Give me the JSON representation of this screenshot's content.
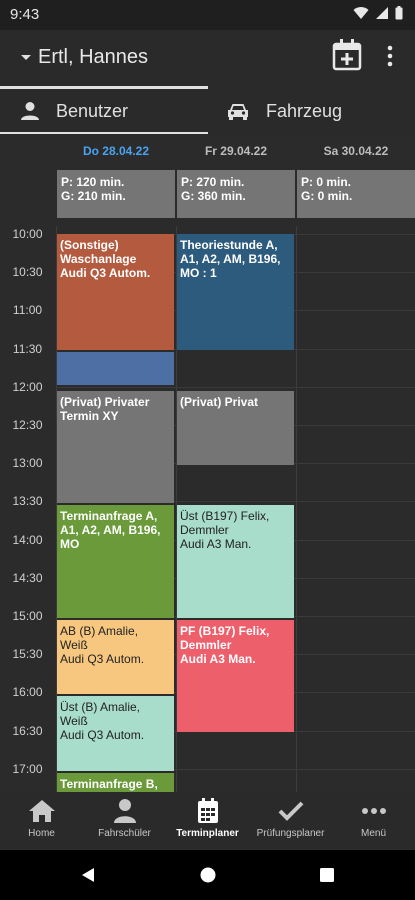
{
  "status": {
    "time": "9:43"
  },
  "appbar": {
    "title": "Ertl, Hannes"
  },
  "tabs": [
    {
      "label": "Benutzer",
      "icon": "person-icon",
      "active": true
    },
    {
      "label": "Fahrzeug",
      "icon": "car-icon",
      "active": false
    }
  ],
  "days": [
    {
      "label": "Do 28.04.22",
      "today": true,
      "summary_p": "P: 120 min.",
      "summary_g": "G: 210 min."
    },
    {
      "label": "Fr 29.04.22",
      "today": false,
      "summary_p": "P: 270 min.",
      "summary_g": "G: 360 min."
    },
    {
      "label": "Sa 30.04.22",
      "today": false,
      "summary_p": "P: 0 min.",
      "summary_g": "G: 0 min."
    }
  ],
  "hours": [
    "10:00",
    "10:30",
    "11:00",
    "11:30",
    "12:00",
    "12:30",
    "13:00",
    "13:30",
    "14:00",
    "14:30",
    "15:00",
    "15:30",
    "16:00",
    "16:30",
    "17:00"
  ],
  "events": [
    {
      "day": 0,
      "lines": [
        "(Sonstige)",
        "Waschanlage",
        "Audi Q3 Autom."
      ],
      "color": "#b35a3f"
    },
    {
      "day": 0,
      "lines": [],
      "color": "#4d6fa3"
    },
    {
      "day": 0,
      "lines": [
        "(Privat) Privater",
        "Termin XY"
      ],
      "color": "#757575"
    },
    {
      "day": 0,
      "lines": [
        "Terminanfrage A,",
        "A1, A2, AM, B196,",
        "MO"
      ],
      "color": "#6a9a3a"
    },
    {
      "day": 0,
      "lines": [
        "AB (B) Amalie,",
        "Weiß",
        "Audi Q3 Autom."
      ],
      "color": "#f7c77f"
    },
    {
      "day": 0,
      "lines": [
        "Üst (B) Amalie,",
        "Weiß",
        "Audi Q3 Autom."
      ],
      "color": "#a8dccb"
    },
    {
      "day": 0,
      "lines": [
        "Terminanfrage B,"
      ],
      "color": "#6a9a3a"
    },
    {
      "day": 1,
      "lines": [
        "Theoriestunde A,",
        "A1, A2, AM, B196,",
        "MO : 1"
      ],
      "color": "#2d5b7e"
    },
    {
      "day": 1,
      "lines": [
        "(Privat) Privat"
      ],
      "color": "#757575"
    },
    {
      "day": 1,
      "lines": [
        "Üst (B197) Felix,",
        "Demmler",
        "Audi A3 Man."
      ],
      "color": "#a8dccb"
    },
    {
      "day": 1,
      "lines": [
        "PF (B197) Felix,",
        "Demmler",
        "Audi A3 Man."
      ],
      "color": "#ee5f6c"
    }
  ],
  "nav": [
    {
      "label": "Home",
      "icon": "home-icon",
      "active": false
    },
    {
      "label": "Fahrschüler",
      "icon": "person-icon",
      "active": false
    },
    {
      "label": "Terminplaner",
      "icon": "calendar-icon",
      "active": true
    },
    {
      "label": "Prüfungsplaner",
      "icon": "check-icon",
      "active": false
    },
    {
      "label": "Menü",
      "icon": "more-horiz-icon",
      "active": false
    }
  ]
}
